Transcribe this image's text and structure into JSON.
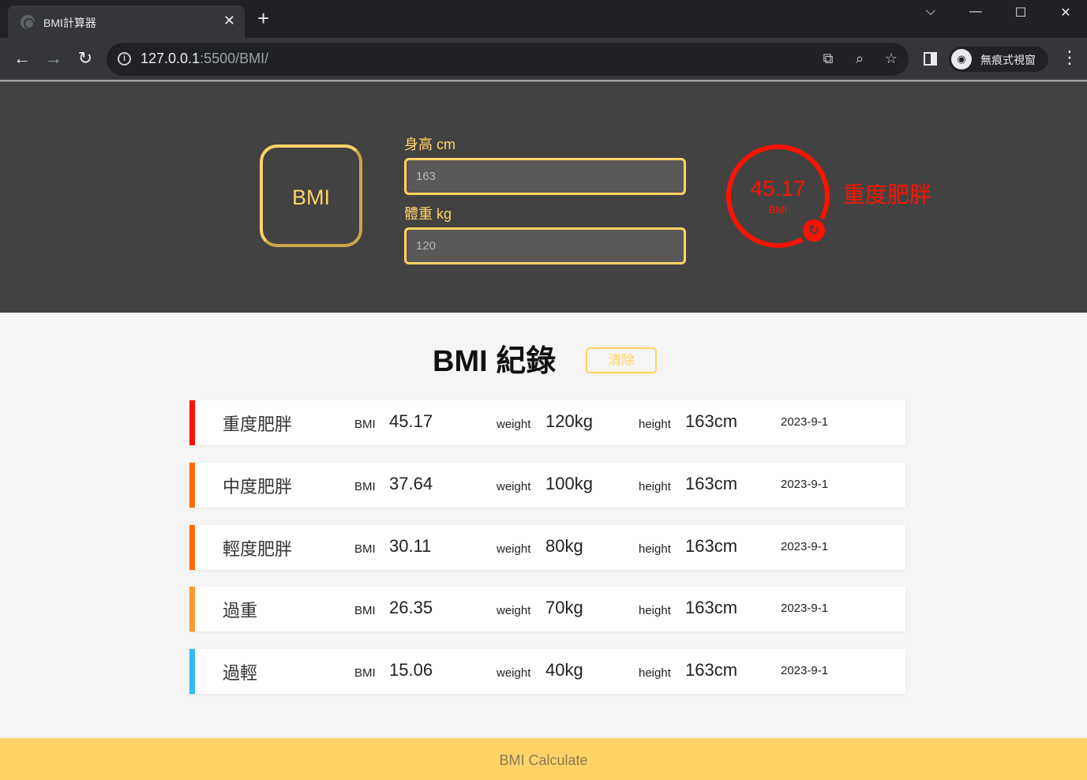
{
  "browser": {
    "tab_title": "BMI計算器",
    "tab_close": "✕",
    "new_tab": "+",
    "url_host": "127.0.0.1",
    "url_path": ":5500/BMI/",
    "incognito_label": "無痕式視窗",
    "window_controls": [
      "⌵",
      "—",
      "☐",
      "✕"
    ]
  },
  "calculator": {
    "logo_text": "BMI",
    "height_label": "身高 cm",
    "height_value": "163",
    "weight_label": "體重 kg",
    "weight_value": "120",
    "result_value": "45.17",
    "result_unit": "BMI",
    "result_status": "重度肥胖"
  },
  "records": {
    "title": "BMI 紀錄",
    "clear_label": "清除",
    "bmi_label": "BMI",
    "weight_label": "weight",
    "height_label": "height",
    "items": [
      {
        "status": "重度肥胖",
        "bmi": "45.17",
        "weight": "120kg",
        "height": "163cm",
        "date": "2023-9-1",
        "color": "#ff1200"
      },
      {
        "status": "中度肥胖",
        "bmi": "37.64",
        "weight": "100kg",
        "height": "163cm",
        "date": "2023-9-1",
        "color": "#ff6c03"
      },
      {
        "status": "輕度肥胖",
        "bmi": "30.11",
        "weight": "80kg",
        "height": "163cm",
        "date": "2023-9-1",
        "color": "#ff6c03"
      },
      {
        "status": "過重",
        "bmi": "26.35",
        "weight": "70kg",
        "height": "163cm",
        "date": "2023-9-1",
        "color": "#ff982d"
      },
      {
        "status": "過輕",
        "bmi": "15.06",
        "weight": "40kg",
        "height": "163cm",
        "date": "2023-9-1",
        "color": "#31baf9"
      }
    ]
  },
  "footer": {
    "label": "BMI Calculate"
  }
}
